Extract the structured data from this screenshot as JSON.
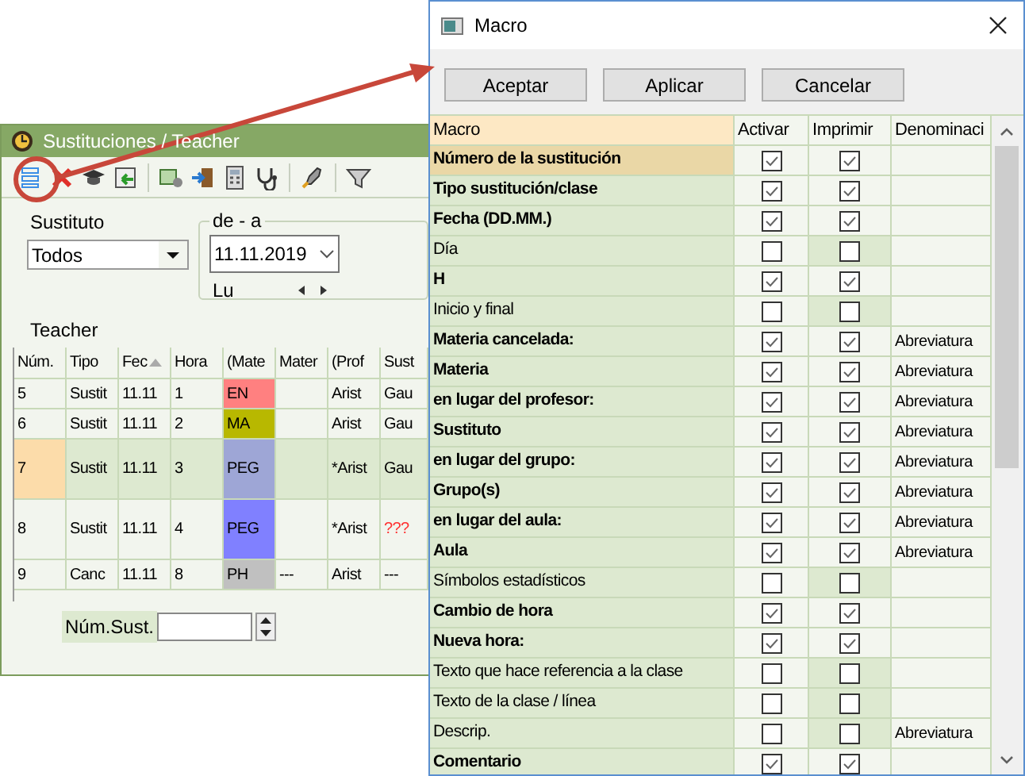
{
  "substitution_window": {
    "title": "Sustituciones / Teacher",
    "substitute_label": "Sustituto",
    "substitute_value": "Todos",
    "date_group_label": "de - a",
    "date_value": "11.11.2019",
    "weekday": "Lu",
    "grid_title": "Teacher",
    "columns": [
      {
        "label": "Núm.",
        "sorted": false
      },
      {
        "label": "Tipo",
        "sorted": false
      },
      {
        "label": "Fec",
        "sorted": true
      },
      {
        "label": "Hora",
        "sorted": false
      },
      {
        "label": "(Mate",
        "sorted": false
      },
      {
        "label": "Mater",
        "sorted": false
      },
      {
        "label": "(Prof",
        "sorted": false
      },
      {
        "label": "Sust",
        "sorted": false
      }
    ],
    "rows": [
      {
        "selected": false,
        "color": "#ff8080",
        "cells": [
          "5",
          "Sustit",
          "11.11",
          "1",
          "EN",
          "",
          "Arist",
          "Gau"
        ],
        "warning": false
      },
      {
        "selected": false,
        "color": "#b8b800",
        "cells": [
          "6",
          "Sustit",
          "11.11",
          "2",
          "MA",
          "",
          "Arist",
          "Gau"
        ],
        "warning": false
      },
      {
        "selected": true,
        "color": "#9ea6d6",
        "cells": [
          "7",
          "Sustit",
          "11.11",
          "3",
          "PEG",
          "",
          "*Arist",
          "Gau"
        ],
        "warning": false
      },
      {
        "selected": false,
        "color": "#8080ff",
        "cells": [
          "8",
          "Sustit",
          "11.11",
          "4",
          "PEG",
          "",
          "*Arist",
          "???"
        ],
        "warning": true
      },
      {
        "selected": false,
        "color": "#c0c0c0",
        "cells": [
          "9",
          "Canc",
          "11.11",
          "8",
          "PH",
          "---",
          "Arist",
          "---"
        ],
        "warning": false
      }
    ],
    "number_label": "Núm.Sust."
  },
  "macro_dialog": {
    "title": "Macro",
    "buttons": [
      "Aceptar",
      "Aplicar",
      "Cancelar"
    ],
    "columns": [
      "Macro",
      "Activar",
      "Imprimir",
      "Denominaci"
    ],
    "rows": [
      {
        "label": "Número de la sustitución",
        "selected": true,
        "activate": true,
        "print": true
      },
      {
        "label": "Tipo sustitución/clase",
        "selected": false,
        "activate": true,
        "print": true
      },
      {
        "label": "Fecha (DD.MM.)",
        "selected": false,
        "activate": true,
        "print": true
      },
      {
        "label": "Día",
        "selected": false,
        "activate": false,
        "print": false
      },
      {
        "label": "H",
        "selected": false,
        "activate": true,
        "print": true
      },
      {
        "label": "Inicio y final",
        "selected": false,
        "activate": false,
        "print": false
      },
      {
        "label": "Materia cancelada:",
        "selected": false,
        "activate": true,
        "print": true,
        "name": "Abreviatura"
      },
      {
        "label": "Materia",
        "selected": false,
        "activate": true,
        "print": true,
        "name": "Abreviatura"
      },
      {
        "label": "en lugar del profesor:",
        "selected": false,
        "activate": true,
        "print": true,
        "name": "Abreviatura"
      },
      {
        "label": "Sustituto",
        "selected": false,
        "activate": true,
        "print": true,
        "name": "Abreviatura"
      },
      {
        "label": "en lugar del grupo:",
        "selected": false,
        "activate": true,
        "print": true,
        "name": "Abreviatura"
      },
      {
        "label": "Grupo(s)",
        "selected": false,
        "activate": true,
        "print": true,
        "name": "Abreviatura"
      },
      {
        "label": "en lugar del aula:",
        "selected": false,
        "activate": true,
        "print": true,
        "name": "Abreviatura"
      },
      {
        "label": "Aula",
        "selected": false,
        "activate": true,
        "print": true,
        "name": "Abreviatura"
      },
      {
        "label": "Símbolos estadísticos",
        "selected": false,
        "activate": false,
        "print": false
      },
      {
        "label": "Cambio de hora",
        "selected": false,
        "activate": true,
        "print": true
      },
      {
        "label": "Nueva hora:",
        "selected": false,
        "activate": true,
        "print": true
      },
      {
        "label": "Texto que hace referencia a la clase",
        "selected": false,
        "activate": false,
        "print": false
      },
      {
        "label": "Texto de la clase / línea",
        "selected": false,
        "activate": false,
        "print": false
      },
      {
        "label": "Descrip.",
        "selected": false,
        "activate": false,
        "print": false,
        "name": "Abreviatura"
      },
      {
        "label": "Comentario",
        "selected": false,
        "activate": true,
        "print": true
      }
    ]
  }
}
